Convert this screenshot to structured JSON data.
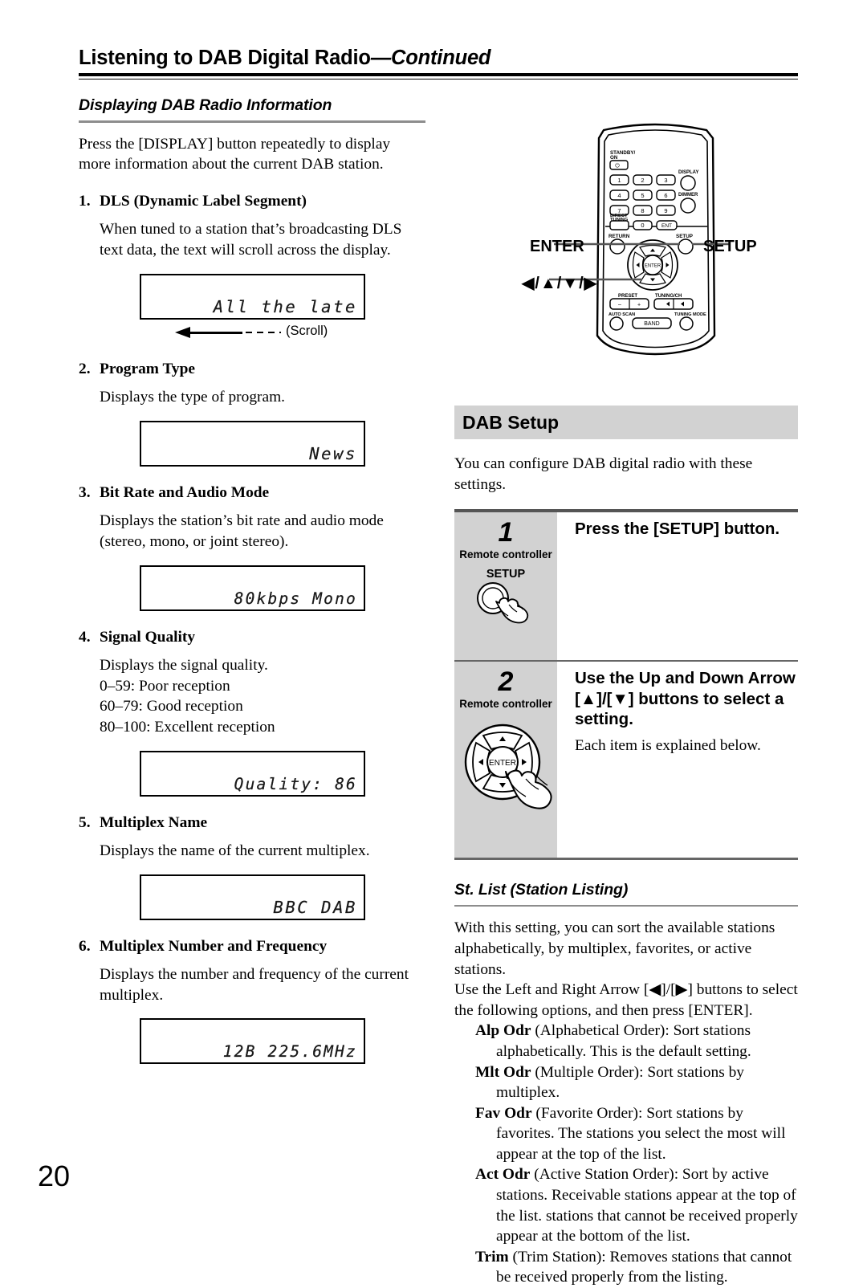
{
  "running_head": {
    "title": "Listening to DAB Digital Radio",
    "suffix": "—Continued"
  },
  "page_number": "20",
  "left_column": {
    "section_heading": "Displaying DAB Radio Information",
    "intro": "Press the [DISPLAY] button repeatedly to display more information about the current DAB station.",
    "items": [
      {
        "number": "1.",
        "heading": "DLS (Dynamic Label Segment)",
        "body": "When tuned to a station that’s broadcasting DLS text data, the text will scroll across the display.",
        "lcd": "All the late",
        "scroll_label": "(Scroll)"
      },
      {
        "number": "2.",
        "heading": "Program Type",
        "body": "Displays the type of program.",
        "lcd": "News"
      },
      {
        "number": "3.",
        "heading": "Bit Rate and Audio Mode",
        "body": "Displays the station’s bit rate and audio mode (stereo, mono, or joint stereo).",
        "lcd": "80kbps Mono"
      },
      {
        "number": "4.",
        "heading": "Signal Quality",
        "body_lines": [
          "Displays the signal quality.",
          "0–59: Poor reception",
          "60–79: Good reception",
          "80–100: Excellent reception"
        ],
        "lcd": "Quality: 86"
      },
      {
        "number": "5.",
        "heading": "Multiplex Name",
        "body": "Displays the name of the current multiplex.",
        "lcd": "BBC DAB"
      },
      {
        "number": "6.",
        "heading": "Multiplex Number and Frequency",
        "body": "Displays the number and frequency of the current multiplex.",
        "lcd": "12B 225.6MHz"
      }
    ]
  },
  "remote": {
    "standby_label": "STANDBY/ON",
    "display_label": "DISPLAY",
    "dimmer_label": "DIMMER",
    "direct_tuning_label": "DIRECT TUNING",
    "return_label": "RETURN",
    "setup_label": "SETUP",
    "enter_label": "ENTER",
    "preset_label": "PRESET",
    "tuning_ch_label": "TUNING/CH",
    "auto_scan_label": "AUTO SCAN",
    "band_label": "BAND",
    "tuning_mode_label": "TUNING MODE",
    "minus": "–",
    "plus": "+",
    "ent_label": "ENT",
    "keys": [
      "1",
      "2",
      "3",
      "4",
      "5",
      "6",
      "7",
      "8",
      "9",
      "0"
    ],
    "callouts": {
      "enter": "ENTER",
      "arrows": "◀/▲/▼/▶",
      "setup": "SETUP"
    }
  },
  "right_column": {
    "band_title": "DAB Setup",
    "band_intro": "You can configure DAB digital radio with these settings.",
    "steps": [
      {
        "number": "1",
        "device": "Remote controller",
        "button_label": "SETUP",
        "heading": "Press the [SETUP] button.",
        "body": ""
      },
      {
        "number": "2",
        "device": "Remote controller",
        "heading": "Use the Up and Down Arrow [▲]/[▼] buttons to select a setting.",
        "body": "Each item is explained below.",
        "enter_label": "ENTER"
      }
    ],
    "stlist": {
      "heading": "St. List (Station Listing)",
      "intro_1": "With this setting, you can sort the available stations alphabetically, by multiplex, favorites, or active stations.",
      "intro_2": "Use the Left and Right Arrow [◀]/[▶] buttons to select the following options, and then press [ENTER].",
      "options": [
        {
          "term": "Alp Odr",
          "desc": " (Alphabetical Order): Sort stations alphabetically. This is the default setting."
        },
        {
          "term": "Mlt Odr",
          "desc": " (Multiple Order): Sort stations by multiplex."
        },
        {
          "term": "Fav Odr",
          "desc": " (Favorite Order): Sort stations by favorites. The stations you select the most will appear at the top of the list."
        },
        {
          "term": "Act Odr",
          "desc": " (Active Station Order): Sort by active stations. Receivable stations appear at the top of the list. stations that cannot be received properly appear at the bottom of the list."
        },
        {
          "term": "Trim",
          "desc": " (Trim Station): Removes stations that cannot be received properly from the listing."
        }
      ]
    }
  }
}
